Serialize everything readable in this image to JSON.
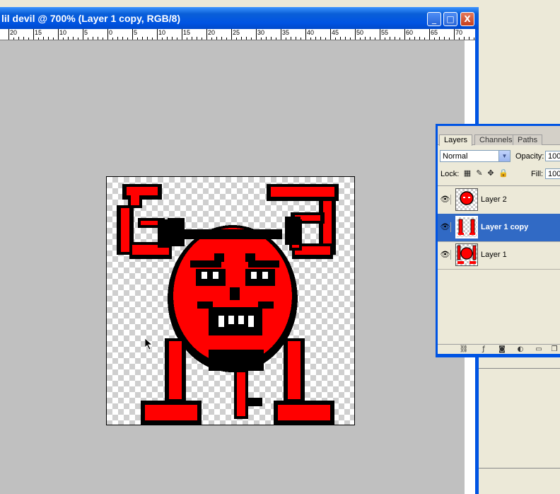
{
  "document": {
    "title": "lil devil @ 700% (Layer 1 copy, RGB/8)",
    "ruler_labels": [
      "20",
      "15",
      "10",
      "5",
      "0",
      "5",
      "10",
      "15",
      "20",
      "25",
      "30",
      "35",
      "40",
      "45",
      "50",
      "55",
      "60",
      "65",
      "70"
    ],
    "window_buttons": {
      "minimize": "_",
      "maximize": "□",
      "close": "X"
    }
  },
  "layers_panel": {
    "tabs": [
      "Layers",
      "Channels",
      "Paths"
    ],
    "blend_mode": "Normal",
    "opacity_label": "Opacity:",
    "opacity_value": "100",
    "lock_label": "Lock:",
    "fill_label": "Fill:",
    "fill_value": "100",
    "layers": [
      {
        "name": "Layer 2",
        "visible": true,
        "selected": false
      },
      {
        "name": "Layer 1 copy",
        "visible": true,
        "selected": true
      },
      {
        "name": "Layer 1",
        "visible": true,
        "selected": false
      }
    ],
    "icons": {
      "visibility": "eye-icon",
      "lock_transparent": "lock-transparent-icon",
      "lock_paint": "brush-icon",
      "lock_position": "move-icon",
      "lock_all": "lock-icon"
    }
  },
  "colors": {
    "devil_red": "#ff0000",
    "selection_blue": "#316ac5",
    "titlebar_blue": "#0054e3"
  }
}
